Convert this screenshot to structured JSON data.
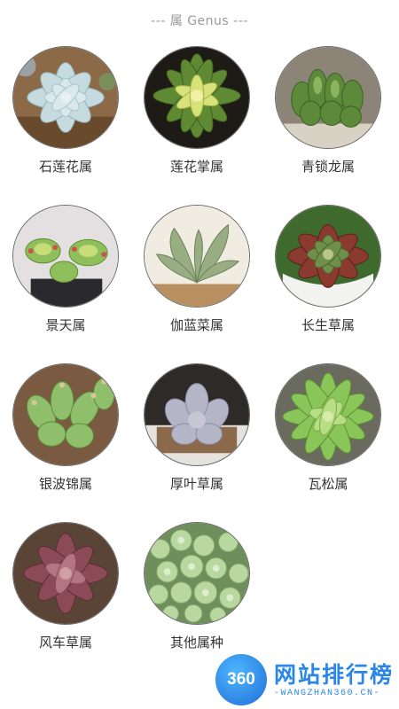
{
  "section": {
    "title": "--- 属 Genus ---"
  },
  "genera": [
    {
      "label": "石莲花属",
      "image": "echeveria-succulent"
    },
    {
      "label": "莲花掌属",
      "image": "aeonium-succulent"
    },
    {
      "label": "青锁龙属",
      "image": "crassula-succulent"
    },
    {
      "label": "景天属",
      "image": "sedum-succulent"
    },
    {
      "label": "伽蓝菜属",
      "image": "kalanchoe-succulent"
    },
    {
      "label": "长生草属",
      "image": "sempervivum-succulent"
    },
    {
      "label": "银波锦属",
      "image": "cotyledon-succulent"
    },
    {
      "label": "厚叶草属",
      "image": "pachyphytum-succulent"
    },
    {
      "label": "瓦松属",
      "image": "orostachys-succulent"
    },
    {
      "label": "风车草属",
      "image": "graptopetalum-succulent"
    },
    {
      "label": "其他属种",
      "image": "other-succulents"
    }
  ],
  "watermark": {
    "logo": "360",
    "name": "网站排行榜",
    "domain": "-WANGZHAN360.CN-"
  }
}
